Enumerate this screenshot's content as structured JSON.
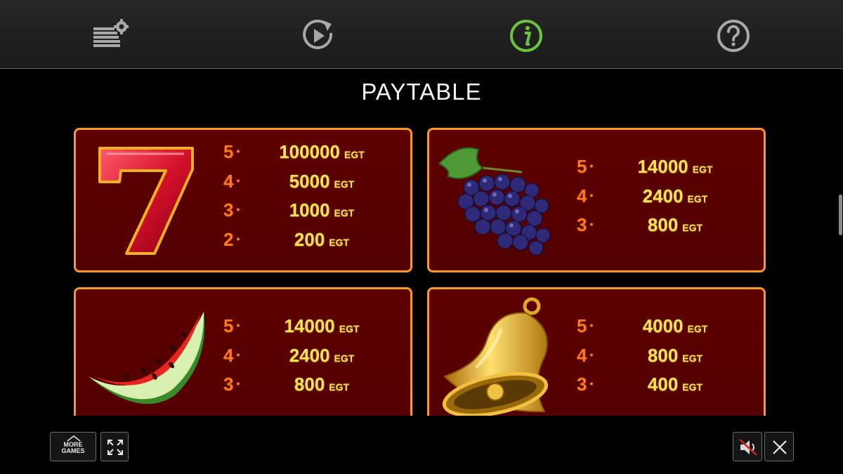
{
  "toolbar": {
    "items": [
      {
        "icon": "settings-icon"
      },
      {
        "icon": "autoplay-icon"
      },
      {
        "icon": "info-icon",
        "active": true,
        "color": "#6cc33d"
      },
      {
        "icon": "help-icon"
      }
    ]
  },
  "title": "PAYTABLE",
  "currency": "EGT",
  "symbols": [
    {
      "name": "seven",
      "icon": "seven-symbol-icon",
      "payouts": [
        {
          "count": "5",
          "amount": "100000"
        },
        {
          "count": "4",
          "amount": "5000"
        },
        {
          "count": "3",
          "amount": "1000"
        },
        {
          "count": "2",
          "amount": "200"
        }
      ]
    },
    {
      "name": "grapes",
      "icon": "grapes-symbol-icon",
      "payouts": [
        {
          "count": "5",
          "amount": "14000"
        },
        {
          "count": "4",
          "amount": "2400"
        },
        {
          "count": "3",
          "amount": "800"
        }
      ]
    },
    {
      "name": "watermelon",
      "icon": "watermelon-symbol-icon",
      "payouts": [
        {
          "count": "5",
          "amount": "14000"
        },
        {
          "count": "4",
          "amount": "2400"
        },
        {
          "count": "3",
          "amount": "800"
        }
      ]
    },
    {
      "name": "bell",
      "icon": "bell-symbol-icon",
      "payouts": [
        {
          "count": "5",
          "amount": "4000"
        },
        {
          "count": "4",
          "amount": "800"
        },
        {
          "count": "3",
          "amount": "400"
        }
      ]
    }
  ],
  "bottom": {
    "more_games_line1": "MORE",
    "more_games_line2": "GAMES",
    "fullscreen_icon": "fullscreen-icon",
    "sound_icon": "sound-muted-icon",
    "close_icon": "close-icon"
  },
  "colors": {
    "card_border": "#f59a28",
    "card_bg": "#5d0100",
    "count_color": "#ff7a18",
    "amount_color": "#ffe35a"
  }
}
